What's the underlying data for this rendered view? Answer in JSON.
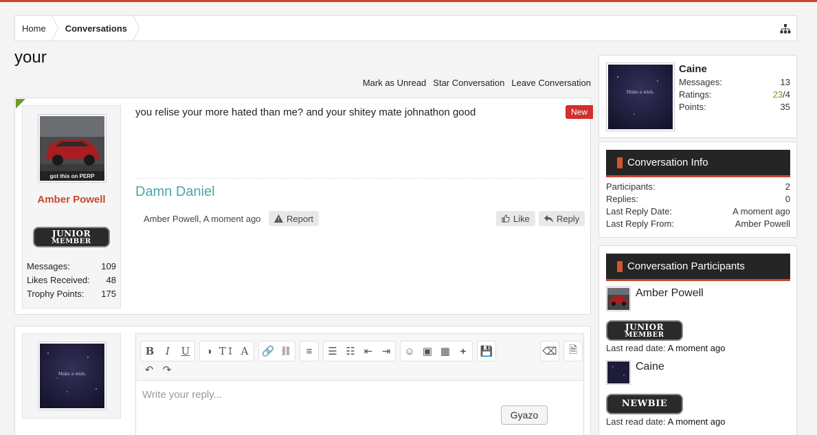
{
  "breadcrumb": {
    "home": "Home",
    "current": "Conversations"
  },
  "page": {
    "title": "your"
  },
  "actions": {
    "mark_unread": "Mark as Unread",
    "star": "Star Conversation",
    "leave": "Leave Conversation"
  },
  "message": {
    "author": "Amber Powell",
    "badge_line1": "Junior",
    "badge_line2": "Member",
    "avatar_caption": "got this on PERP",
    "stats": [
      {
        "label": "Messages:",
        "value": "109"
      },
      {
        "label": "Likes Received:",
        "value": "48"
      },
      {
        "label": "Trophy Points:",
        "value": "175"
      }
    ],
    "body": "you relise your more hated than me? and your shitey mate johnathon good",
    "new_tag": "New",
    "signature": "Damn Daniel",
    "meta": "Amber Powell, A moment ago",
    "report_label": "Report",
    "like_label": "Like",
    "reply_label": "Reply"
  },
  "editor": {
    "placeholder": "Write your reply..."
  },
  "gyazo": {
    "label": "Gyazo"
  },
  "profile": {
    "name": "Caine",
    "avatar_caption": "Make a wish.",
    "stats": [
      {
        "label": "Messages:",
        "value": "13"
      },
      {
        "label": "Ratings:",
        "value_green": "23",
        "value_rest": "/4"
      },
      {
        "label": "Points:",
        "value": "35"
      }
    ]
  },
  "conversation_info": {
    "title": "Conversation Info",
    "rows": [
      {
        "label": "Participants:",
        "value": "2"
      },
      {
        "label": "Replies:",
        "value": "0"
      },
      {
        "label": "Last Reply Date:",
        "value": "A moment ago"
      },
      {
        "label": "Last Reply From:",
        "value": "Amber Powell"
      }
    ]
  },
  "participants": {
    "title": "Conversation Participants",
    "read_label": "Last read date:",
    "items": [
      {
        "name": "Amber Powell",
        "badge": "Junior",
        "badge2": "Member",
        "read": "A moment ago"
      },
      {
        "name": "Caine",
        "badge": "Newbie",
        "read": "A moment ago"
      }
    ]
  },
  "colors": {
    "accent": "#c8482a",
    "signature": "#4aa6a8",
    "ratings_green": "#6a9c2c"
  }
}
